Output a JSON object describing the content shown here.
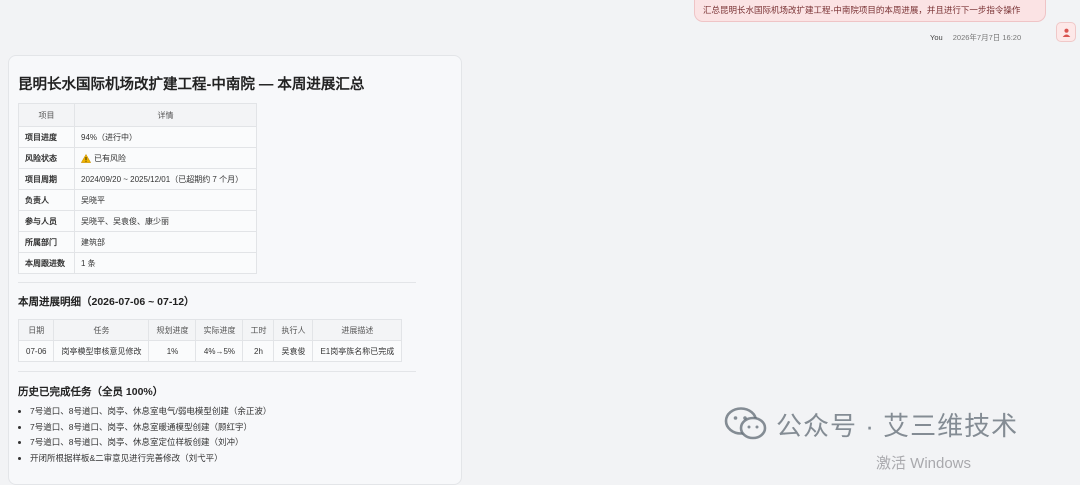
{
  "user_message": {
    "text": "汇总昆明长水国际机场改扩建工程-中南院项目的本周进展，并且进行下一步指令操作",
    "sender": "You",
    "timestamp": "2026年7月7日 16:20"
  },
  "report": {
    "title": "昆明长水国际机场改扩建工程-中南院 — 本周进展汇总",
    "info_headers": [
      "项目",
      "详情"
    ],
    "info_rows": [
      {
        "key": "项目进度",
        "value": "94%（进行中）"
      },
      {
        "key": "风险状态",
        "value": "已有风险",
        "icon": "warning-icon"
      },
      {
        "key": "项目周期",
        "value": "2024/09/20 ~ 2025/12/01（已超期约 7 个月）"
      },
      {
        "key": "负责人",
        "value": "吴晓平"
      },
      {
        "key": "参与人员",
        "value": "吴晓平、吴袁俊、康少丽"
      },
      {
        "key": "所属部门",
        "value": "建筑部"
      },
      {
        "key": "本周跟进数",
        "value": "1 条"
      }
    ],
    "week_title": "本周进展明细（2026-07-06 ~ 07-12）",
    "week_headers": [
      "日期",
      "任务",
      "规划进度",
      "实际进度",
      "工时",
      "执行人",
      "进展描述"
    ],
    "week_rows": [
      [
        "07-06",
        "岗亭模型审核意见修改",
        "1%",
        "4%→5%",
        "2h",
        "吴袁俊",
        "E1岗亭族名称已完成"
      ]
    ],
    "history_title": "历史已完成任务（全员 100%）",
    "history_items": [
      "7号道口、8号道口、岗亭、休息室电气/弱电模型创建（余正波）",
      "7号道口、8号道口、岗亭、休息室暖通模型创建（顾红宇）",
      "7号道口、8号道口、岗亭、休息室定位样板创建（刘冲）",
      "开闭所根据样板&二审意见进行完善修改（刘弋平）"
    ]
  },
  "watermark": {
    "text": "公众号 · 艾三维技术",
    "activate": "激活 Windows"
  },
  "colors": {
    "background": "#f2f3f5",
    "user_bubble": "#fbe3e4",
    "user_avatar": "#d9534f",
    "warning": "#f0b400"
  }
}
